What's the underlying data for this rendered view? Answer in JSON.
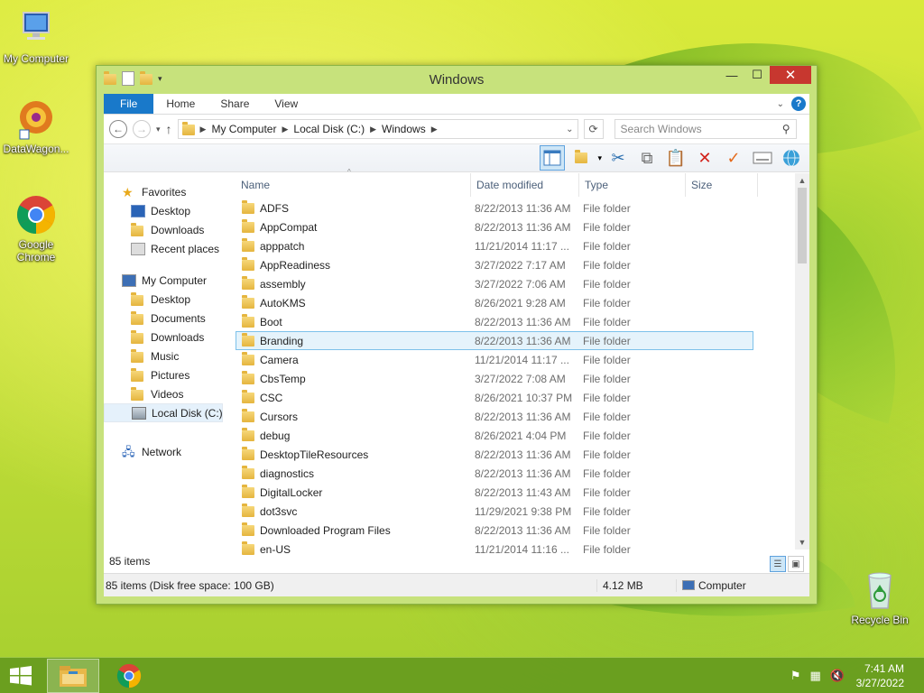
{
  "desktop": {
    "icons": [
      {
        "label": "My Computer",
        "icon": "computer-icon"
      },
      {
        "label": "DataWagon...",
        "icon": "datawagon-icon"
      },
      {
        "label": "Google Chrome",
        "icon": "chrome-icon"
      },
      {
        "label": "Recycle Bin",
        "icon": "recycle-bin-icon"
      }
    ]
  },
  "window": {
    "title": "Windows",
    "ribbon_tabs": [
      "File",
      "Home",
      "Share",
      "View"
    ],
    "address": {
      "segments": [
        "My Computer",
        "Local Disk (C:)",
        "Windows"
      ]
    },
    "search": {
      "placeholder": "Search Windows"
    },
    "nav_pane": {
      "favorites": {
        "label": "Favorites",
        "items": [
          "Desktop",
          "Downloads",
          "Recent places"
        ]
      },
      "computer": {
        "label": "My Computer",
        "items": [
          "Desktop",
          "Documents",
          "Downloads",
          "Music",
          "Pictures",
          "Videos",
          "Local Disk (C:)"
        ]
      },
      "network": {
        "label": "Network"
      }
    },
    "columns": [
      "Name",
      "Date modified",
      "Type",
      "Size"
    ],
    "files": [
      {
        "name": "ADFS",
        "date": "8/22/2013 11:36 AM",
        "type": "File folder"
      },
      {
        "name": "AppCompat",
        "date": "8/22/2013 11:36 AM",
        "type": "File folder"
      },
      {
        "name": "apppatch",
        "date": "11/21/2014 11:17 ...",
        "type": "File folder"
      },
      {
        "name": "AppReadiness",
        "date": "3/27/2022 7:17 AM",
        "type": "File folder"
      },
      {
        "name": "assembly",
        "date": "3/27/2022 7:06 AM",
        "type": "File folder"
      },
      {
        "name": "AutoKMS",
        "date": "8/26/2021 9:28 AM",
        "type": "File folder"
      },
      {
        "name": "Boot",
        "date": "8/22/2013 11:36 AM",
        "type": "File folder"
      },
      {
        "name": "Branding",
        "date": "8/22/2013 11:36 AM",
        "type": "File folder"
      },
      {
        "name": "Camera",
        "date": "11/21/2014 11:17 ...",
        "type": "File folder"
      },
      {
        "name": "CbsTemp",
        "date": "3/27/2022 7:08 AM",
        "type": "File folder"
      },
      {
        "name": "CSC",
        "date": "8/26/2021 10:37 PM",
        "type": "File folder"
      },
      {
        "name": "Cursors",
        "date": "8/22/2013 11:36 AM",
        "type": "File folder"
      },
      {
        "name": "debug",
        "date": "8/26/2021 4:04 PM",
        "type": "File folder"
      },
      {
        "name": "DesktopTileResources",
        "date": "8/22/2013 11:36 AM",
        "type": "File folder"
      },
      {
        "name": "diagnostics",
        "date": "8/22/2013 11:36 AM",
        "type": "File folder"
      },
      {
        "name": "DigitalLocker",
        "date": "8/22/2013 11:43 AM",
        "type": "File folder"
      },
      {
        "name": "dot3svc",
        "date": "11/29/2021 9:38 PM",
        "type": "File folder"
      },
      {
        "name": "Downloaded Program Files",
        "date": "8/22/2013 11:36 AM",
        "type": "File folder"
      },
      {
        "name": "en-US",
        "date": "11/21/2014 11:16 ...",
        "type": "File folder"
      }
    ],
    "selected_file": "Branding",
    "item_count": "85 items",
    "status": {
      "summary": "85 items (Disk free space: 100 GB)",
      "size": "4.12 MB",
      "location": "Computer"
    }
  },
  "taskbar": {
    "time": "7:41 AM",
    "date": "3/27/2022"
  },
  "colors": {
    "accent": "#1979ca",
    "window_frame": "#c7e27c",
    "close": "#c7372f",
    "selection_border": "#7dc1ea",
    "selection_fill": "#e5f3fb"
  }
}
